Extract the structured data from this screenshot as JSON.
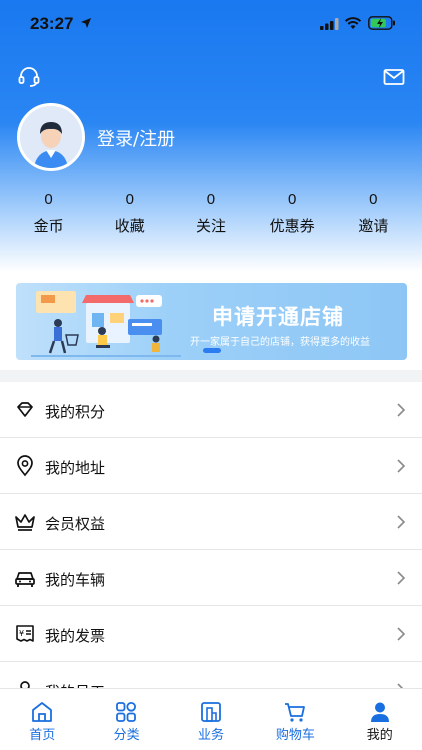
{
  "status_bar": {
    "time": "23:27"
  },
  "profile": {
    "login_label": "登录/注册"
  },
  "stats": [
    {
      "value": "0",
      "label": "金币"
    },
    {
      "value": "0",
      "label": "收藏"
    },
    {
      "value": "0",
      "label": "关注"
    },
    {
      "value": "0",
      "label": "优惠券"
    },
    {
      "value": "0",
      "label": "邀请"
    }
  ],
  "banner": {
    "title": "申请开通店铺",
    "subtitle": "开一家属于自己的店铺，获得更多的收益"
  },
  "menu": [
    {
      "label": "我的积分",
      "icon": "diamond-icon"
    },
    {
      "label": "我的地址",
      "icon": "location-pin-icon"
    },
    {
      "label": "会员权益",
      "icon": "crown-icon"
    },
    {
      "label": "我的车辆",
      "icon": "car-icon"
    },
    {
      "label": "我的发票",
      "icon": "invoice-icon"
    },
    {
      "label": "我的员工",
      "icon": "person-icon"
    }
  ],
  "tabs": [
    {
      "label": "首页",
      "icon": "home-icon"
    },
    {
      "label": "分类",
      "icon": "grid-icon"
    },
    {
      "label": "业务",
      "icon": "building-icon"
    },
    {
      "label": "购物车",
      "icon": "cart-icon"
    },
    {
      "label": "我的",
      "icon": "profile-icon",
      "active": true
    }
  ],
  "colors": {
    "accent": "#1a78f0",
    "tab_color": "#1a6fe0"
  }
}
